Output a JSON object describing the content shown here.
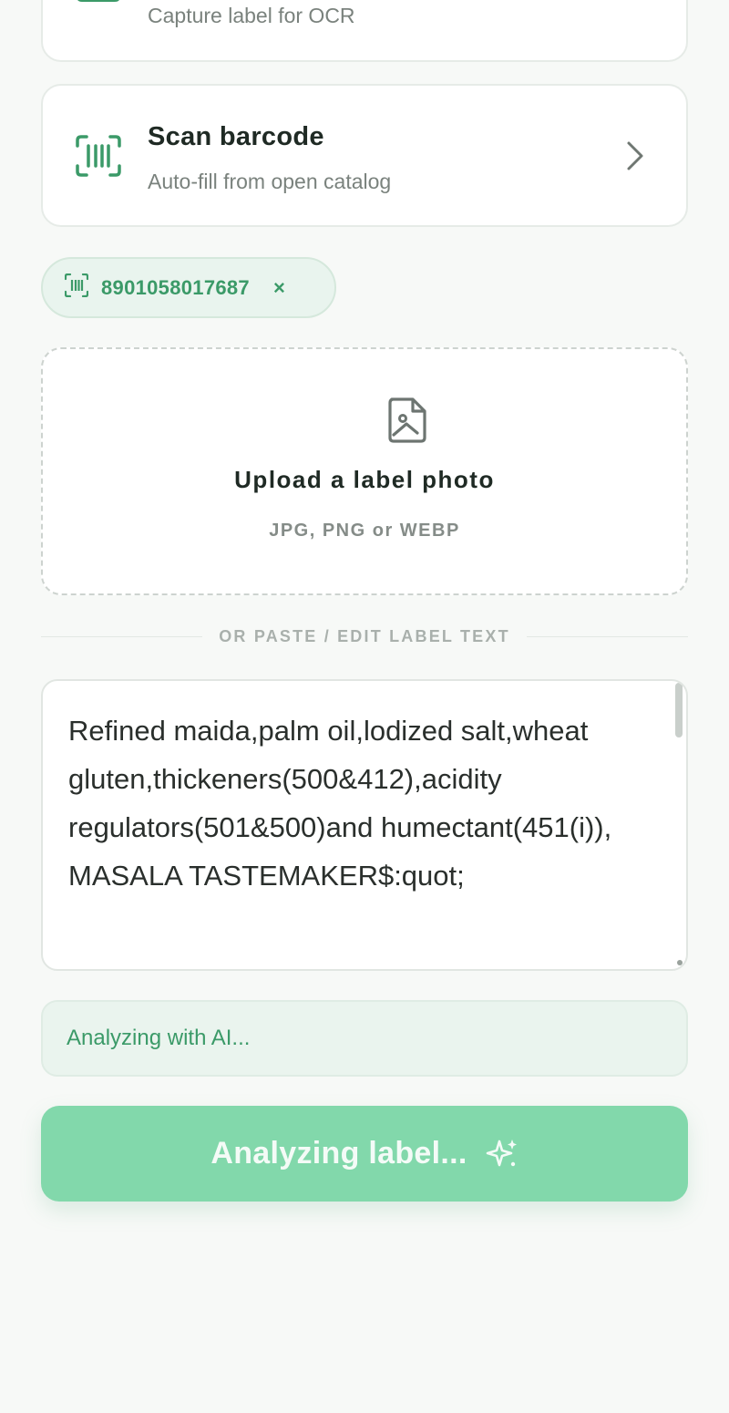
{
  "capture_card": {
    "subtitle": "Capture label for OCR",
    "icon": "camera-icon"
  },
  "barcode_card": {
    "title": "Scan barcode",
    "subtitle": "Auto-fill from open catalog",
    "icon": "barcode-scan-icon",
    "chevron_icon": "chevron-right-icon"
  },
  "barcode_chip": {
    "code": "8901058017687",
    "icon": "barcode-icon",
    "remove_label": "×"
  },
  "upload": {
    "title": "Upload a label photo",
    "formats": "JPG, PNG or WEBP",
    "icon": "image-file-icon"
  },
  "divider": {
    "label": "OR PASTE / EDIT LABEL TEXT"
  },
  "label_text": {
    "value": "Refined maida,palm oil,lodized salt,wheat gluten,thickeners(500&412),acidity regulators(501&500)and humectant(451(i)), MASALA TASTEMAKER$:quot;"
  },
  "status": {
    "message": "Analyzing with AI..."
  },
  "analyze_button": {
    "label": "Analyzing label...",
    "icon": "sparkle-icon"
  },
  "colors": {
    "accent": "#3b9a68",
    "button": "#82d8ab",
    "status_bg": "#eaf4ee"
  }
}
